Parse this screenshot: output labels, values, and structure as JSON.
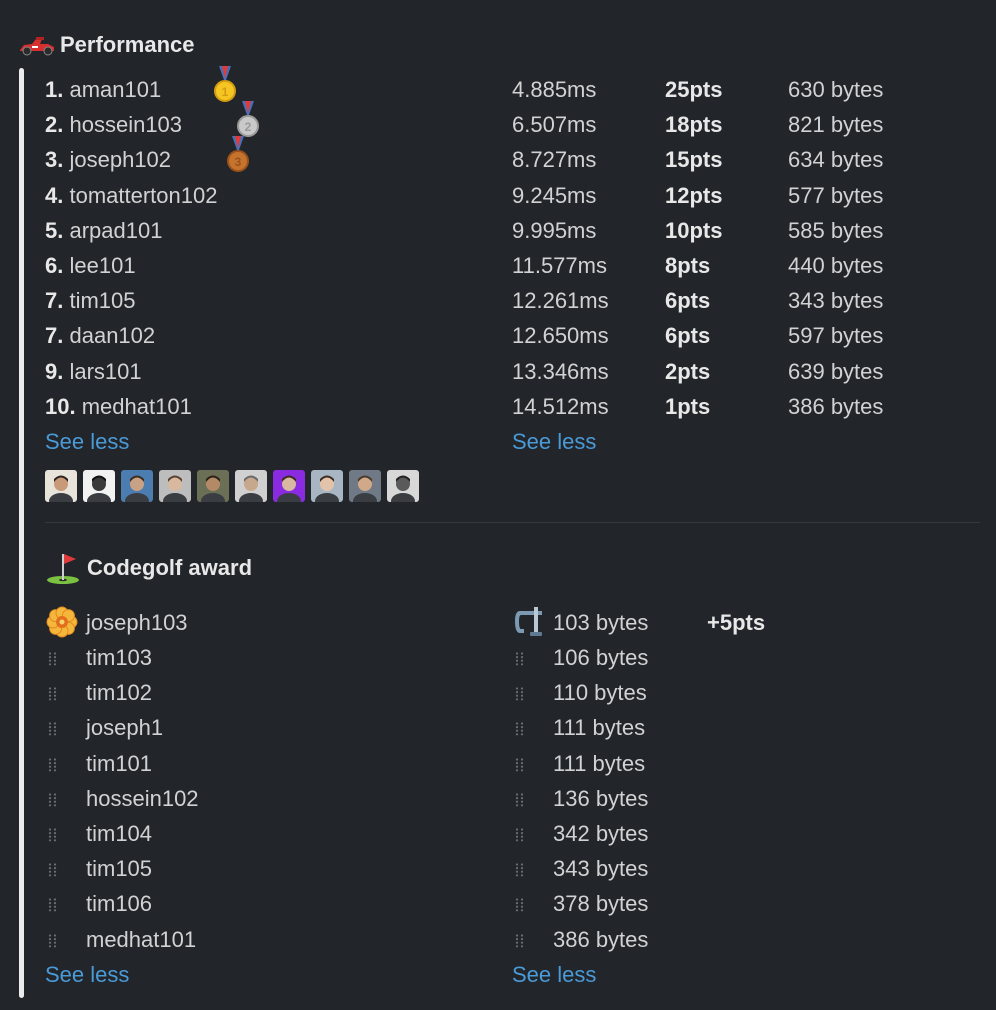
{
  "performance": {
    "title": "Performance",
    "icon": "race-car-icon",
    "rows": [
      {
        "rank": "1.",
        "name": "aman101",
        "medal": "gold",
        "medal_num": "1",
        "time": "4.885ms",
        "pts": "25pts",
        "bytes": "630 bytes"
      },
      {
        "rank": "2.",
        "name": "hossein103",
        "medal": "silver",
        "medal_num": "2",
        "time": "6.507ms",
        "pts": "18pts",
        "bytes": "821 bytes"
      },
      {
        "rank": "3.",
        "name": "joseph102",
        "medal": "bronze",
        "medal_num": "3",
        "time": "8.727ms",
        "pts": "15pts",
        "bytes": "634 bytes"
      },
      {
        "rank": "4.",
        "name": "tomatterton102",
        "medal": "",
        "time": "9.245ms",
        "pts": "12pts",
        "bytes": "577 bytes"
      },
      {
        "rank": "5.",
        "name": "arpad101",
        "medal": "",
        "time": "9.995ms",
        "pts": "10pts",
        "bytes": "585 bytes"
      },
      {
        "rank": "6.",
        "name": "lee101",
        "medal": "",
        "time": "11.577ms",
        "pts": "8pts",
        "bytes": "440 bytes"
      },
      {
        "rank": "7.",
        "name": "tim105",
        "medal": "",
        "time": "12.261ms",
        "pts": "6pts",
        "bytes": "343 bytes"
      },
      {
        "rank": "7.",
        "name": "daan102",
        "medal": "",
        "time": "12.650ms",
        "pts": "6pts",
        "bytes": "597 bytes"
      },
      {
        "rank": "9.",
        "name": "lars101",
        "medal": "",
        "time": "13.346ms",
        "pts": "2pts",
        "bytes": "639 bytes"
      },
      {
        "rank": "10.",
        "name": "medhat101",
        "medal": "",
        "time": "14.512ms",
        "pts": "1pts",
        "bytes": "386 bytes"
      }
    ],
    "see_less_left": "See less",
    "see_less_right": "See less"
  },
  "avatars": [
    {
      "bg": "#e8e4dc",
      "skin": "#c99a78",
      "hair": "#2a2420"
    },
    {
      "bg": "#f2f2f2",
      "skin": "#3a3a3a",
      "hair": "#111111"
    },
    {
      "bg": "#4c7db0",
      "skin": "#c9a184",
      "hair": "#3a2c22"
    },
    {
      "bg": "#bdbdbd",
      "skin": "#d8b9a0",
      "hair": "#5a4030"
    },
    {
      "bg": "#6b6f55",
      "skin": "#b48a66",
      "hair": "#2a2018"
    },
    {
      "bg": "#d0d0d0",
      "skin": "#c8a88c",
      "hair": "#6a6a6a"
    },
    {
      "bg": "#8a2be2",
      "skin": "#d8b8a0",
      "hair": "#3a2a20"
    },
    {
      "bg": "#a7b6c2",
      "skin": "#e3c4aa",
      "hair": "#3c2c20"
    },
    {
      "bg": "#6f7a86",
      "skin": "#d0a98a",
      "hair": "#4a3a2a"
    },
    {
      "bg": "#d8d8d8",
      "skin": "#5a5a5a",
      "hair": "#222222"
    }
  ],
  "codegolf": {
    "title": "Codegolf award",
    "icon": "golf-flag-icon",
    "rows": [
      {
        "name": "joseph103",
        "bytes": "103 bytes",
        "bonus": "+5pts",
        "winner": true
      },
      {
        "name": "tim103",
        "bytes": "106 bytes",
        "bonus": "",
        "winner": false
      },
      {
        "name": "tim102",
        "bytes": "110 bytes",
        "bonus": "",
        "winner": false
      },
      {
        "name": "joseph1",
        "bytes": "111 bytes",
        "bonus": "",
        "winner": false
      },
      {
        "name": "tim101",
        "bytes": "111 bytes",
        "bonus": "",
        "winner": false
      },
      {
        "name": "hossein102",
        "bytes": "136 bytes",
        "bonus": "",
        "winner": false
      },
      {
        "name": "tim104",
        "bytes": "342 bytes",
        "bonus": "",
        "winner": false
      },
      {
        "name": "tim105",
        "bytes": "343 bytes",
        "bonus": "",
        "winner": false
      },
      {
        "name": "tim106",
        "bytes": "378 bytes",
        "bonus": "",
        "winner": false
      },
      {
        "name": "medhat101",
        "bytes": "386 bytes",
        "bonus": "",
        "winner": false
      }
    ],
    "see_less_left": "See less",
    "see_less_right": "See less"
  },
  "colors": {
    "background": "#222529",
    "text": "#d1d2d3",
    "link": "#4a9ad8",
    "attachment_bar": "#ececec"
  }
}
